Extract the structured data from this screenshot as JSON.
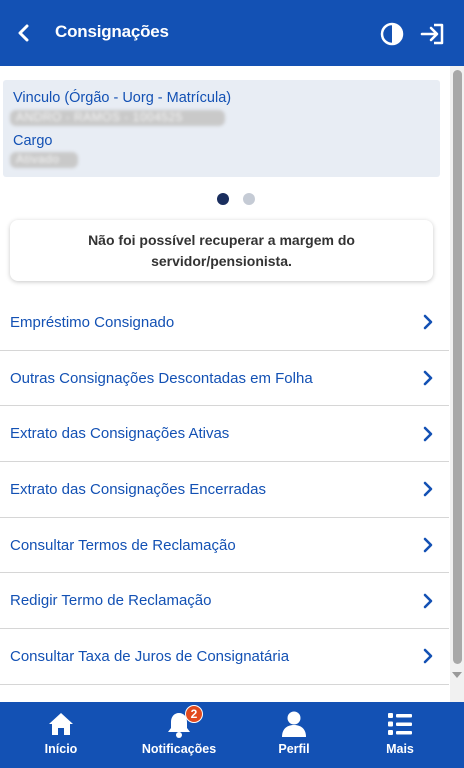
{
  "header": {
    "title": "Consignações",
    "back_icon": "chevron-left-icon",
    "contrast_icon": "contrast-icon",
    "logout_icon": "logout-icon",
    "background": "#1351b4"
  },
  "vinculo_card": {
    "vinculo_label": "Vinculo (Órgão - Uorg - Matrícula)",
    "vinculo_value": "ANDRO - RAMOS - 1004525",
    "cargo_label": "Cargo",
    "cargo_value": "Ativado"
  },
  "carousel": {
    "active_index": 0,
    "count": 2
  },
  "alert": {
    "message": "Não foi possível recuperar a margem do servidor/pensionista."
  },
  "menu": {
    "items": [
      {
        "label": "Empréstimo Consignado"
      },
      {
        "label": "Outras Consignações Descontadas em Folha"
      },
      {
        "label": "Extrato das Consignações Ativas"
      },
      {
        "label": "Extrato das Consignações Encerradas"
      },
      {
        "label": "Consultar Termos de Reclamação"
      },
      {
        "label": "Redigir Termo de Reclamação"
      },
      {
        "label": "Consultar Taxa de Juros de Consignatária"
      }
    ]
  },
  "bottom_nav": {
    "items": [
      {
        "label": "Início",
        "icon": "home-icon"
      },
      {
        "label": "Notificações",
        "icon": "bell-icon",
        "badge": "2"
      },
      {
        "label": "Perfil",
        "icon": "user-icon"
      },
      {
        "label": "Mais",
        "icon": "list-icon"
      }
    ]
  },
  "colors": {
    "primary": "#1351b4",
    "link": "#1351b4",
    "badge": "#e24a1e",
    "card_bg": "#e8edf4"
  }
}
